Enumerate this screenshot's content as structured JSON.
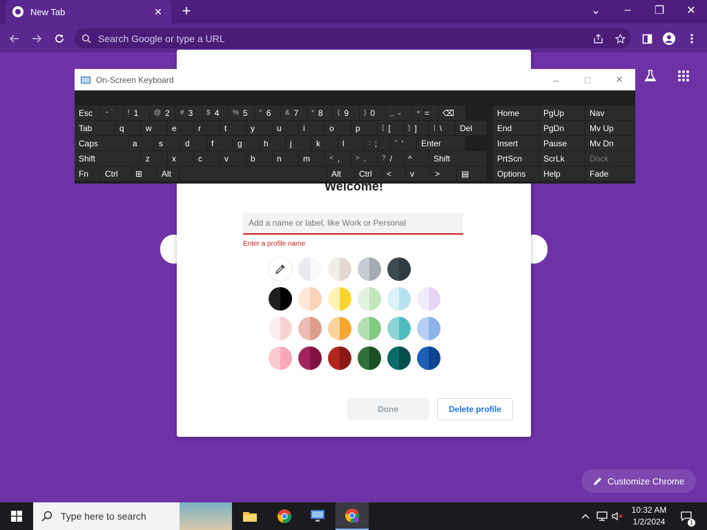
{
  "browser": {
    "tab": {
      "title": "New Tab",
      "close": "✕"
    },
    "new_tab": "+",
    "window_controls": {
      "dropdown": "⌄",
      "minimize": "–",
      "restore": "❐",
      "close": "✕"
    },
    "omnibox": {
      "placeholder": "Search Google or type a URL"
    }
  },
  "ntp": {
    "customize_label": "Customize Chrome"
  },
  "dialog": {
    "title": "Welcome!",
    "input_placeholder": "Add a name or label, like Work or Personal",
    "input_value": "",
    "error": "Enter a profile name",
    "done_label": "Done",
    "delete_label": "Delete profile",
    "swatches": [
      {
        "l": "#e8eaed",
        "r": "#f8f9fa"
      },
      {
        "l": "#f1ede9",
        "r": "#e2dad2"
      },
      {
        "l": "#c8cbd2",
        "r": "#a6aab3"
      },
      {
        "l": "#3e4a52",
        "r": "#2f3a41"
      },
      {
        "l": "#1f1f1f",
        "r": "#000000"
      },
      {
        "l": "#fde7d8",
        "r": "#fbd2b6"
      },
      {
        "l": "#fdf2b8",
        "r": "#fcd42e"
      },
      {
        "l": "#e3f3df",
        "r": "#c3e6bb"
      },
      {
        "l": "#dcf1f7",
        "r": "#b5e2f0"
      },
      {
        "l": "#f3ecfb",
        "r": "#e4d5f6"
      },
      {
        "l": "#fcecee",
        "r": "#f7d3d8"
      },
      {
        "l": "#ecbcb2",
        "r": "#df9d8e"
      },
      {
        "l": "#fbd39e",
        "r": "#f9a532"
      },
      {
        "l": "#b5dfb2",
        "r": "#82c983"
      },
      {
        "l": "#8fd4d4",
        "r": "#4fbcbc"
      },
      {
        "l": "#b6cff4",
        "r": "#8ab4ea"
      },
      {
        "l": "#f9c9d2",
        "r": "#f7a7b6"
      },
      {
        "l": "#a3245c",
        "r": "#82123f"
      },
      {
        "l": "#b3261e",
        "r": "#8b1a14"
      },
      {
        "l": "#2e6f3a",
        "r": "#1d4f26"
      },
      {
        "l": "#0b6b66",
        "r": "#064f4b"
      },
      {
        "l": "#1c5fb5",
        "r": "#0d4591"
      },
      {
        "l": "#7a5fbf",
        "r": "#5e3fa8"
      }
    ],
    "selected_index": 22,
    "check": "✓"
  },
  "osk": {
    "title": "On-Screen Keyboard",
    "title_controls": [
      "–",
      "□",
      "✕"
    ],
    "keys": [
      {
        "t": "Esc"
      },
      {
        "s": "~ `",
        "t": ""
      },
      {
        "s": "!",
        "t": "1"
      },
      {
        "s": "@",
        "t": "2"
      },
      {
        "s": "#",
        "t": "3"
      },
      {
        "s": "$",
        "t": "4"
      },
      {
        "s": "%",
        "t": "5"
      },
      {
        "s": "^",
        "t": "6"
      },
      {
        "s": "&",
        "t": "7"
      },
      {
        "s": "*",
        "t": "8"
      },
      {
        "s": "(",
        "t": "9"
      },
      {
        "s": ")",
        "t": "0"
      },
      {
        "s": "_",
        "t": "-"
      },
      {
        "s": "+",
        "t": "="
      },
      {
        "t": "⌫"
      },
      {
        "t": "Tab"
      },
      {
        "t": "q"
      },
      {
        "t": "w"
      },
      {
        "t": "e"
      },
      {
        "t": "r"
      },
      {
        "t": "t"
      },
      {
        "t": "y"
      },
      {
        "t": "u"
      },
      {
        "t": "i"
      },
      {
        "t": "o"
      },
      {
        "t": "p"
      },
      {
        "s": "{",
        "t": "["
      },
      {
        "s": "}",
        "t": "]"
      },
      {
        "s": "|",
        "t": "\\"
      },
      {
        "t": "Del"
      },
      {
        "t": "Caps"
      },
      {
        "t": "a"
      },
      {
        "t": "s"
      },
      {
        "t": "d"
      },
      {
        "t": "f"
      },
      {
        "t": "g"
      },
      {
        "t": "h"
      },
      {
        "t": "j"
      },
      {
        "t": "k"
      },
      {
        "t": "l"
      },
      {
        "s": ":",
        "t": ";"
      },
      {
        "s": "\"",
        "t": "'"
      },
      {
        "t": "Enter"
      },
      {
        "t": "Shift"
      },
      {
        "t": "z"
      },
      {
        "t": "x"
      },
      {
        "t": "c"
      },
      {
        "t": "v"
      },
      {
        "t": "b"
      },
      {
        "t": "n"
      },
      {
        "t": "m"
      },
      {
        "s": "<",
        "t": ","
      },
      {
        "s": ">",
        "t": "."
      },
      {
        "s": "?",
        "t": "/"
      },
      {
        "t": "^"
      },
      {
        "t": "Shift"
      },
      {
        "t": "Fn"
      },
      {
        "t": "Ctrl"
      },
      {
        "t": "⊞"
      },
      {
        "t": "Alt"
      },
      {
        "t": ""
      },
      {
        "t": "Alt"
      },
      {
        "t": "Ctrl"
      },
      {
        "t": "<"
      },
      {
        "t": "v"
      },
      {
        "t": ">"
      },
      {
        "t": "▤"
      },
      {
        "t": "Home"
      },
      {
        "t": "PgUp"
      },
      {
        "t": "Nav"
      },
      {
        "t": "End"
      },
      {
        "t": "PgDn"
      },
      {
        "t": "Mv Up"
      },
      {
        "t": "Insert"
      },
      {
        "t": "Pause"
      },
      {
        "t": "Mv Dn"
      },
      {
        "t": "PrtScn"
      },
      {
        "t": "ScrLk"
      },
      {
        "t": "Dock"
      },
      {
        "t": "Options"
      },
      {
        "t": "Help"
      },
      {
        "t": "Fade"
      }
    ]
  },
  "taskbar": {
    "search_placeholder": "Type here to search",
    "time": "10:32 AM",
    "date": "1/2/2024",
    "notification_count": "1"
  }
}
